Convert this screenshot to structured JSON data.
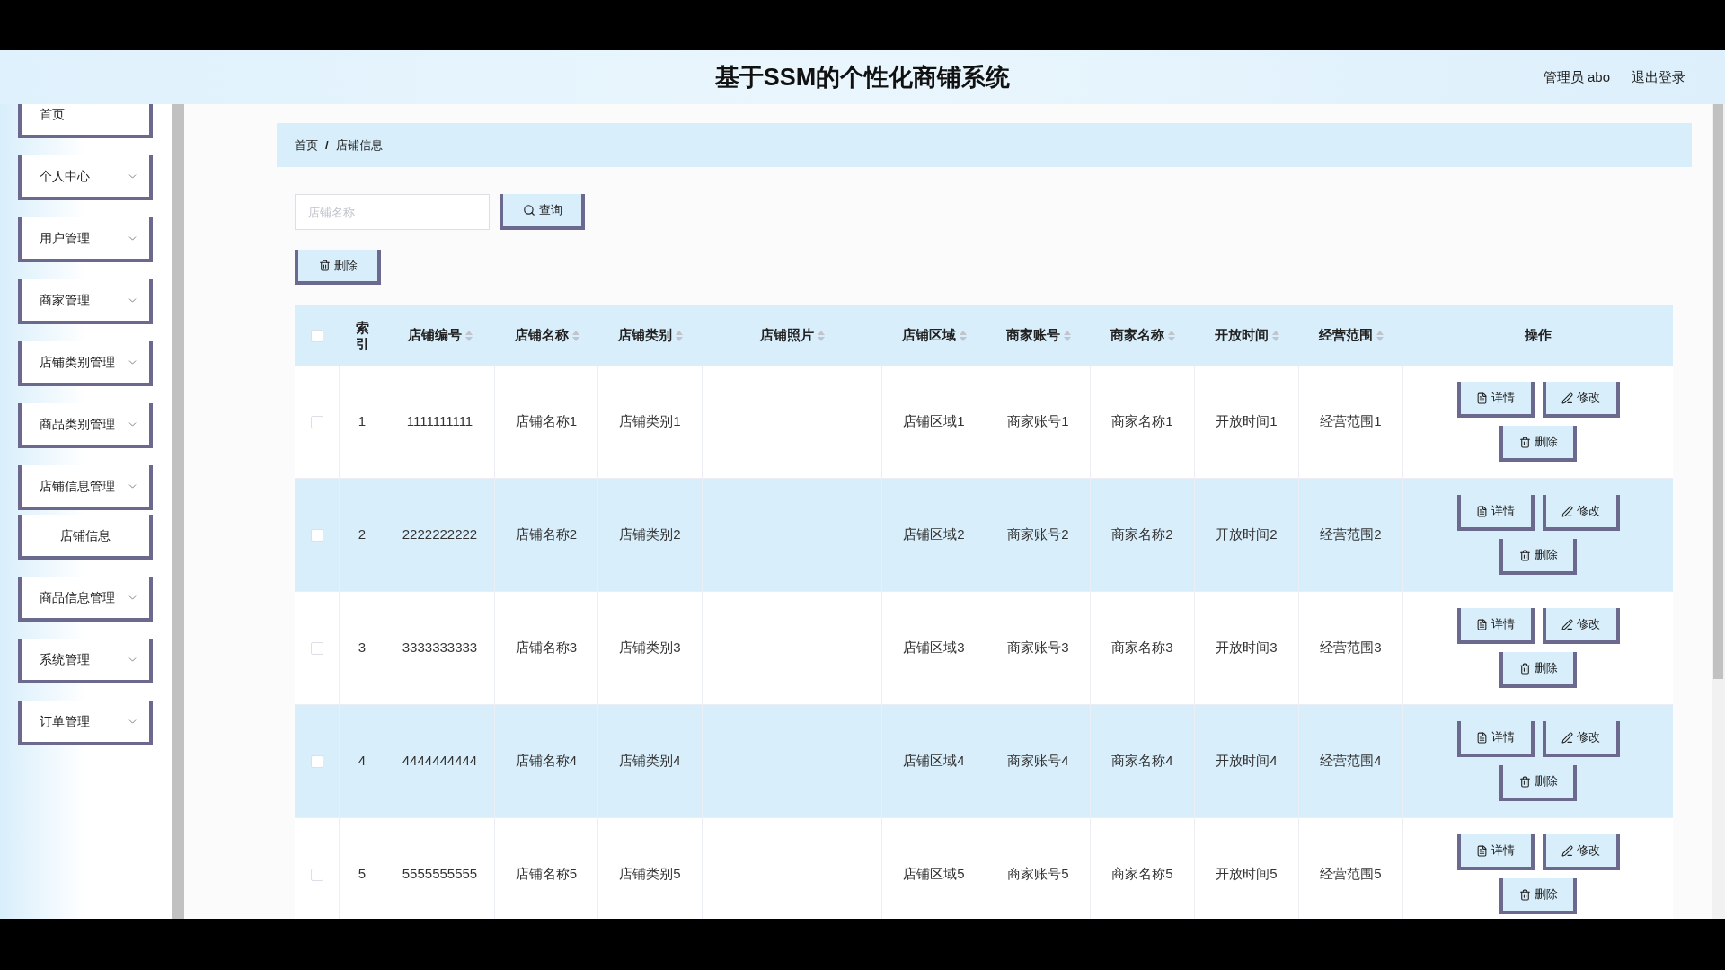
{
  "header": {
    "title": "基于SSM的个性化商铺系统",
    "user": "管理员 abo",
    "logout": "退出登录"
  },
  "sidebar": {
    "items": [
      {
        "label": "首页",
        "kind": "link"
      },
      {
        "label": "个人中心",
        "kind": "menu"
      },
      {
        "label": "用户管理",
        "kind": "menu"
      },
      {
        "label": "商家管理",
        "kind": "menu"
      },
      {
        "label": "店铺类别管理",
        "kind": "menu"
      },
      {
        "label": "商品类别管理",
        "kind": "menu"
      },
      {
        "label": "店铺信息管理",
        "kind": "menu",
        "children": [
          {
            "label": "店铺信息"
          }
        ]
      },
      {
        "label": "商品信息管理",
        "kind": "menu"
      },
      {
        "label": "系统管理",
        "kind": "menu"
      },
      {
        "label": "订单管理",
        "kind": "menu"
      }
    ]
  },
  "breadcrumb": {
    "items": [
      "首页",
      "店铺信息"
    ],
    "separator": "/"
  },
  "search": {
    "placeholder": "店铺名称",
    "button": "查询"
  },
  "toolbar": {
    "delete": "删除"
  },
  "table": {
    "select_all": false,
    "columns": [
      {
        "label": "索引",
        "sortable": false
      },
      {
        "label": "店铺编号",
        "sortable": true
      },
      {
        "label": "店铺名称",
        "sortable": true
      },
      {
        "label": "店铺类别",
        "sortable": true
      },
      {
        "label": "店铺照片",
        "sortable": true
      },
      {
        "label": "店铺区域",
        "sortable": true
      },
      {
        "label": "商家账号",
        "sortable": true
      },
      {
        "label": "商家名称",
        "sortable": true
      },
      {
        "label": "开放时间",
        "sortable": true
      },
      {
        "label": "经营范围",
        "sortable": true
      },
      {
        "label": "操作",
        "sortable": false
      }
    ],
    "rows": [
      {
        "checked": false,
        "cells": [
          "1",
          "1111111111",
          "店铺名称1",
          "店铺类别1",
          "",
          "店铺区域1",
          "商家账号1",
          "商家名称1",
          "开放时间1",
          "经营范围1"
        ],
        "actions": [
          "详情",
          "修改",
          "删除"
        ]
      },
      {
        "checked": false,
        "cells": [
          "2",
          "2222222222",
          "店铺名称2",
          "店铺类别2",
          "",
          "店铺区域2",
          "商家账号2",
          "商家名称2",
          "开放时间2",
          "经营范围2"
        ],
        "actions": [
          "详情",
          "修改",
          "删除"
        ]
      },
      {
        "checked": false,
        "cells": [
          "3",
          "3333333333",
          "店铺名称3",
          "店铺类别3",
          "",
          "店铺区域3",
          "商家账号3",
          "商家名称3",
          "开放时间3",
          "经营范围3"
        ],
        "actions": [
          "详情",
          "修改",
          "删除"
        ]
      },
      {
        "checked": false,
        "cells": [
          "4",
          "4444444444",
          "店铺名称4",
          "店铺类别4",
          "",
          "店铺区域4",
          "商家账号4",
          "商家名称4",
          "开放时间4",
          "经营范围4"
        ],
        "actions": [
          "详情",
          "修改",
          "删除"
        ]
      },
      {
        "checked": false,
        "cells": [
          "5",
          "5555555555",
          "店铺名称5",
          "店铺类别5",
          "",
          "店铺区域5",
          "商家账号5",
          "商家名称5",
          "开放时间5",
          "经营范围5"
        ],
        "actions": [
          "详情",
          "修改",
          "删除"
        ]
      }
    ]
  }
}
